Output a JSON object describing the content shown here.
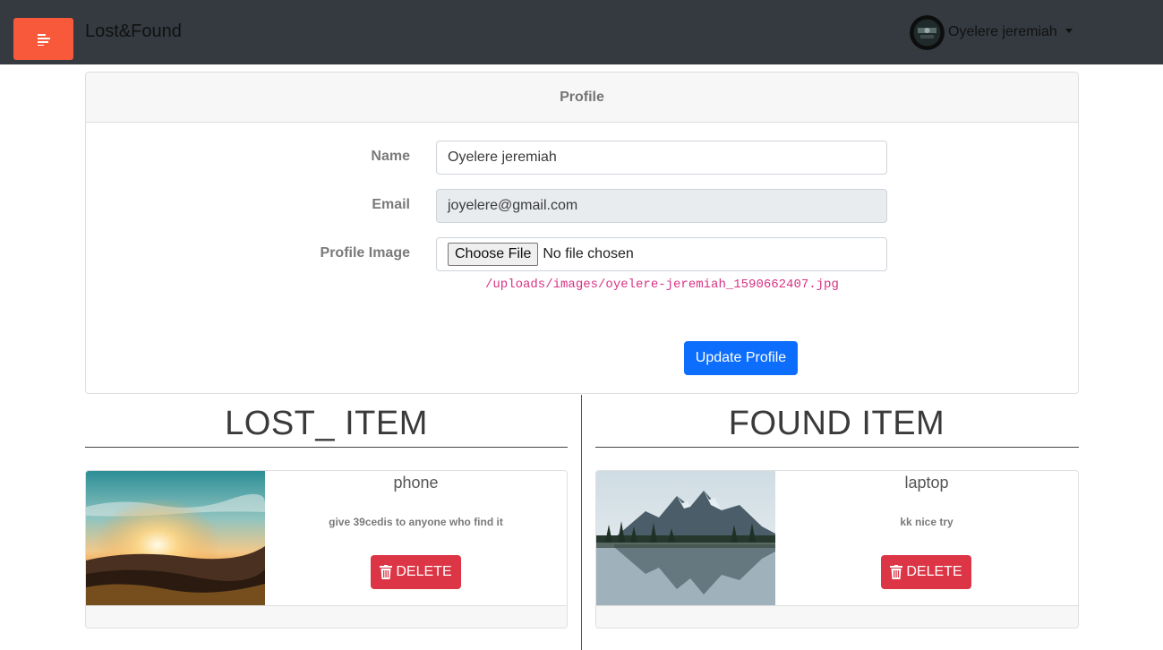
{
  "navbar": {
    "brand": "Lost&Found",
    "user_name": "Oyelere jeremiah",
    "menu_icon": "menu-icon",
    "menu_color": "#f8593b"
  },
  "profile": {
    "header": "Profile",
    "name_label": "Name",
    "name_value": "Oyelere jeremiah",
    "email_label": "Email",
    "email_value": "joyelere@gmail.com",
    "image_label": "Profile Image",
    "file_button": "Choose File",
    "file_status": "No file chosen",
    "image_path": "/uploads/images/oyelere-jeremiah_1590662407.jpg",
    "update_button": "Update Profile"
  },
  "lost": {
    "title": "LOST_ ITEM",
    "items": [
      {
        "title": "phone",
        "description": "give 39cedis to anyone who find it",
        "delete_label": "DELETE"
      }
    ]
  },
  "found": {
    "title": "FOUND ITEM",
    "items": [
      {
        "title": "laptop",
        "description": "kk nice try",
        "delete_label": "DELETE"
      }
    ]
  },
  "colors": {
    "primary": "#0d6efd",
    "danger": "#dc3545",
    "navbar": "#343a40"
  }
}
